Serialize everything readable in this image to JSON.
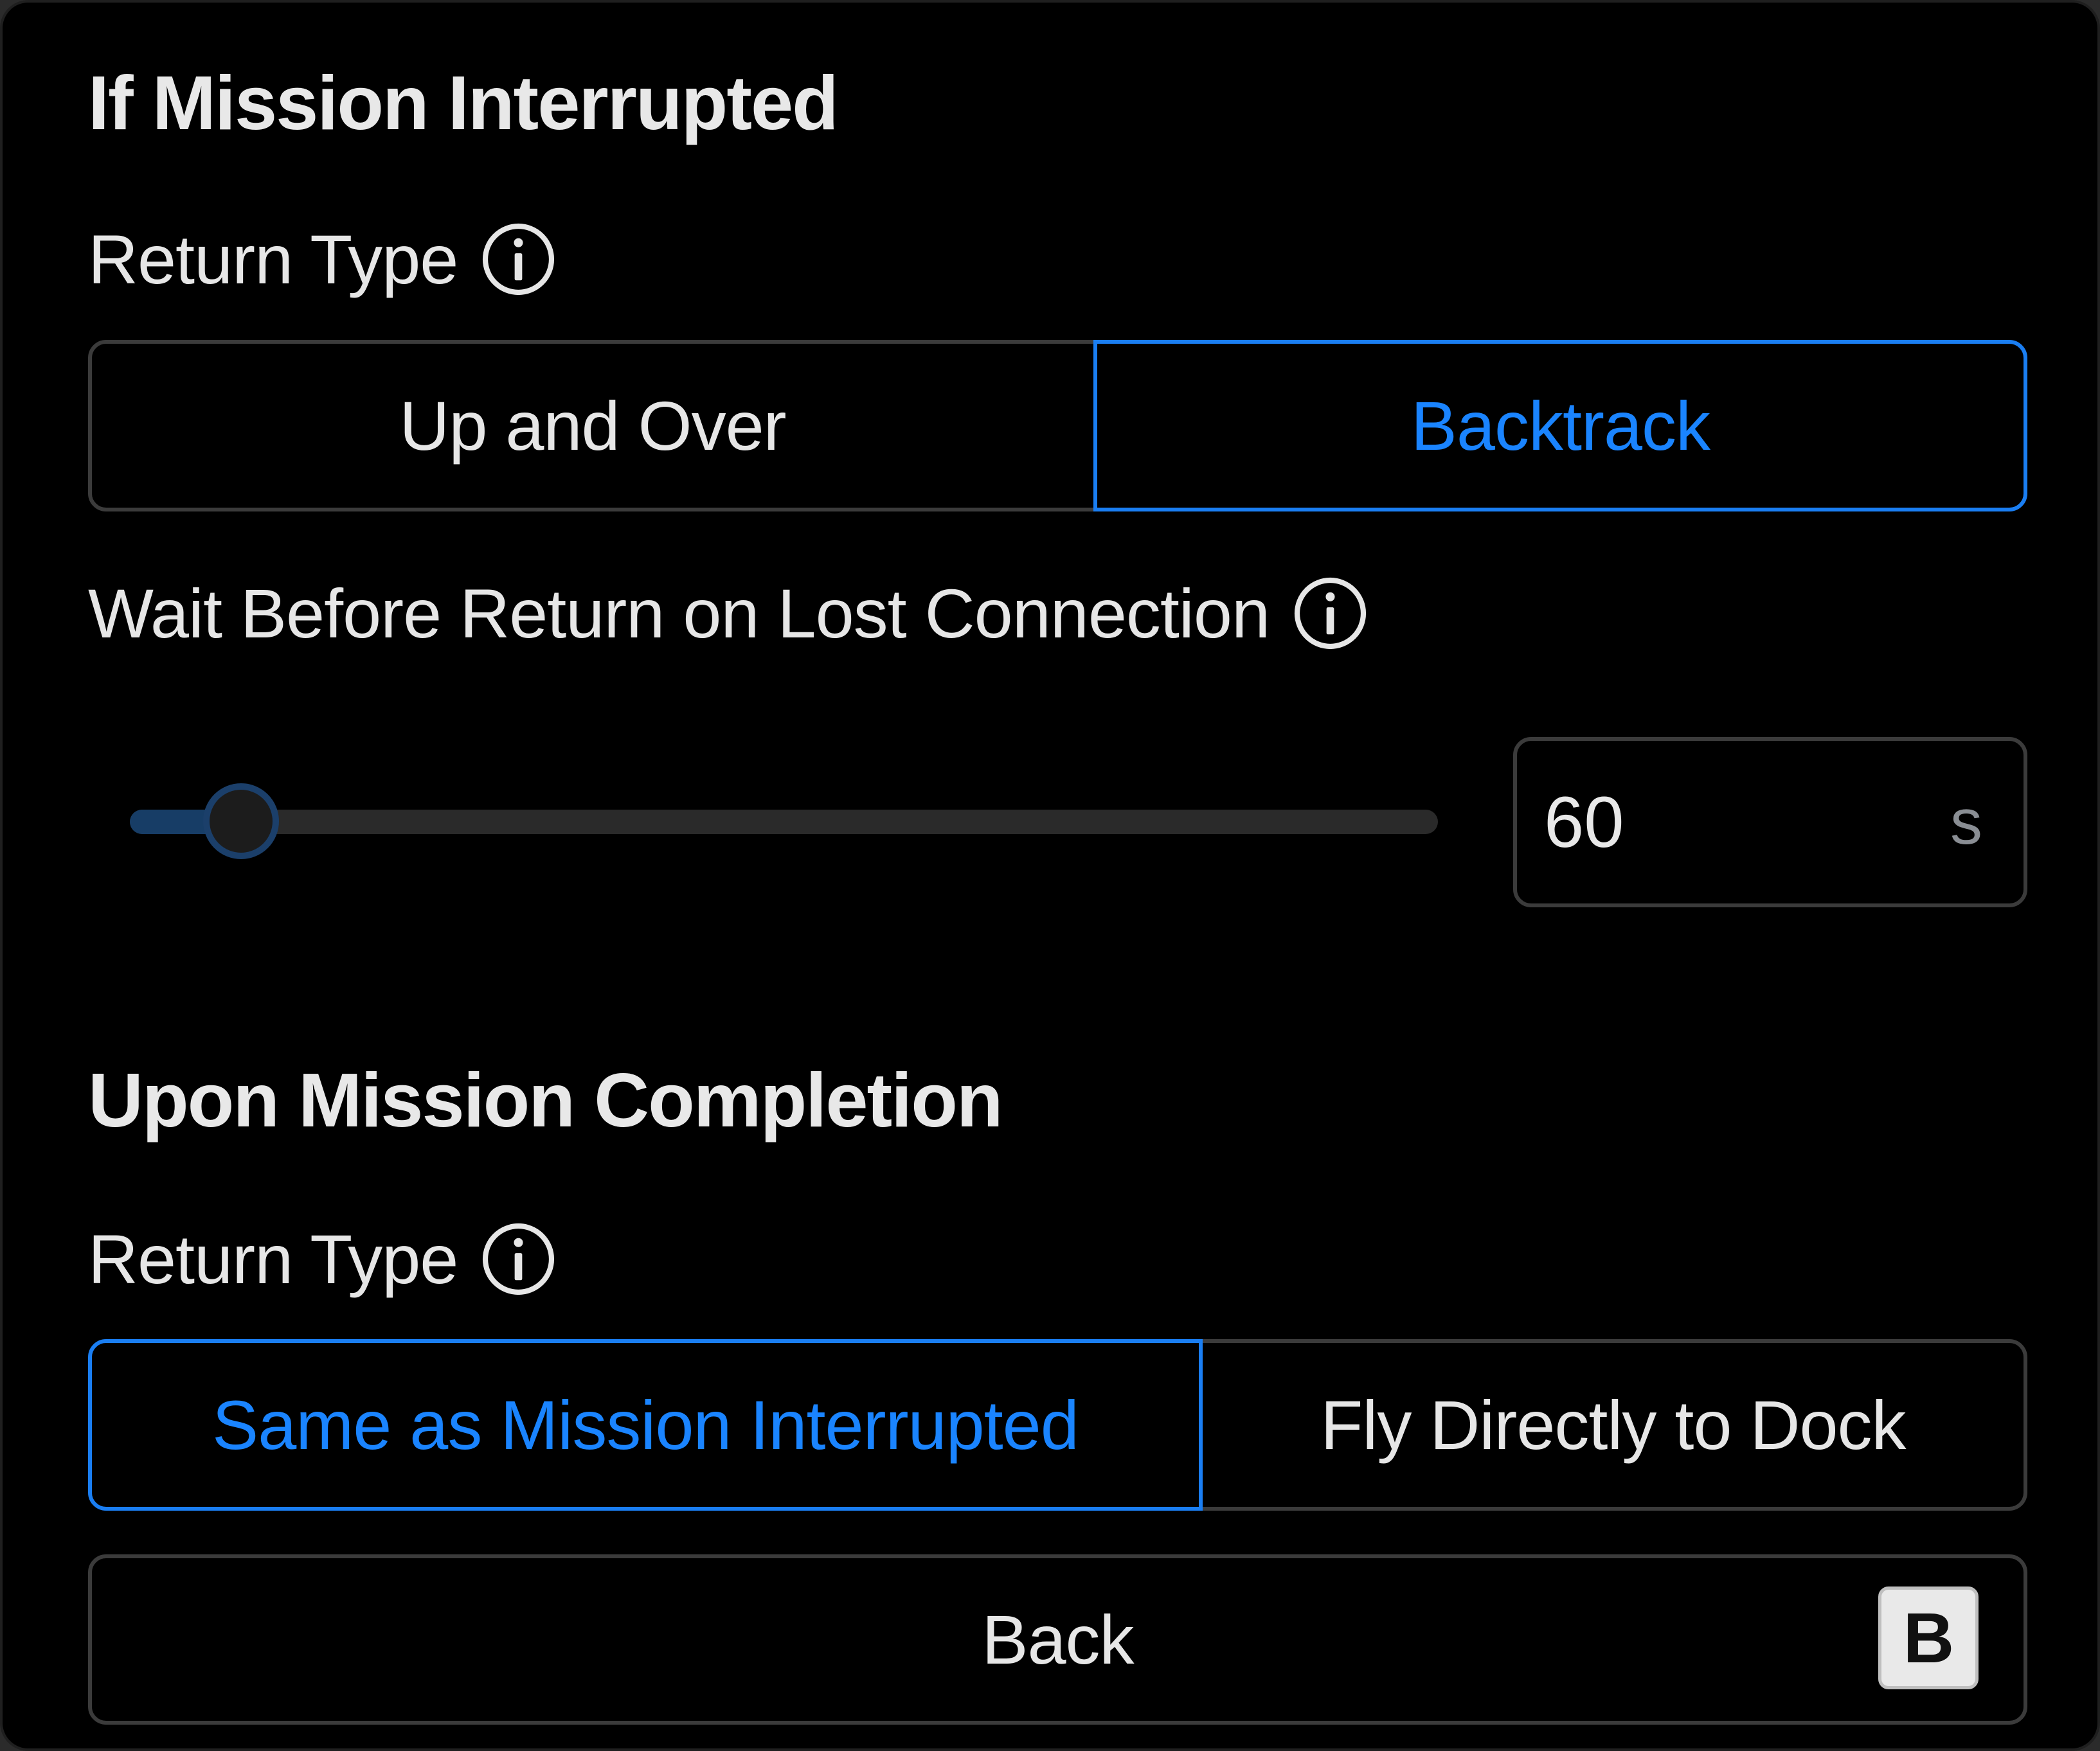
{
  "interrupted": {
    "title": "If Mission Interrupted",
    "return_type": {
      "label": "Return Type",
      "options": [
        "Up and Over",
        "Backtrack"
      ],
      "selected": "Backtrack"
    },
    "wait": {
      "label": "Wait Before Return on Lost Connection",
      "value": "60",
      "unit": "s",
      "slider_fraction": 0.085
    }
  },
  "completion": {
    "title": "Upon Mission Completion",
    "return_type": {
      "label": "Return Type",
      "options": [
        "Same as Mission Interrupted",
        "Fly Directly to Dock"
      ],
      "selected": "Same as Mission Interrupted"
    }
  },
  "back": {
    "label": "Back",
    "shortcut": "B"
  },
  "icons": {
    "info": "info-circle-icon"
  },
  "colors": {
    "background": "#000000",
    "accent": "#1a84ff",
    "border": "#3b3b3b",
    "text": "#e6e6e6"
  }
}
